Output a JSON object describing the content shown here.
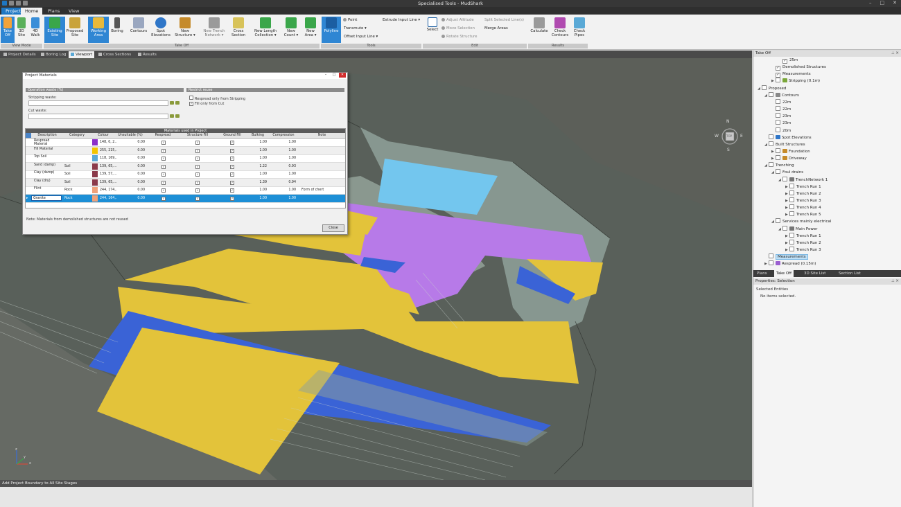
{
  "window": {
    "title": "Specialised Tools - MudShark",
    "min": "–",
    "max": "□",
    "close": "✕"
  },
  "ribbon_tabs": [
    "Project",
    "Home",
    "Plans",
    "View"
  ],
  "ribbon": {
    "take_off": "Take\nOff",
    "site_3d": "3D\nSite",
    "walk_4d": "4D\nWalk",
    "existing_site": "Existing\nSite",
    "proposed_site": "Proposed\nSite",
    "working_area": "Working\nArea",
    "boring": "Boring",
    "contours": "Contours",
    "spot_elevations": "Spot\nElevations",
    "new_structure": "New\nStructure ▾",
    "new_trench_network": "New Trench\nNetwork ▾",
    "cross_section": "Cross\nSection",
    "new_length_collection": "New Length\nCollection ▾",
    "new_count": "New\nCount ▾",
    "new_area": "New\nArea ▾",
    "polyline": "Polyline",
    "point": "Point",
    "transmute": "Transmute ▾",
    "offset_input_line": "Offset Input Line ▾",
    "extrude_input_line": "Extrude Input Line ▾",
    "select": "Select",
    "adjust_altitude": "Adjust Altitude",
    "move_selection": "Move Selection",
    "rotate_structure": "Rotate Structure",
    "split_selected_lines": "Split Selected Line(s)",
    "merge_areas": "Merge Areas",
    "calculate": "Calculate",
    "check_contours": "Check\nContours",
    "check_pipes": "Check\nPipes",
    "groups": {
      "view_mode": "View Mode",
      "take_off": "Take Off",
      "tools": "Tools",
      "edit": "Edit",
      "results": "Results"
    }
  },
  "doc_tabs": [
    "Project Details",
    "Boring Log",
    "Viewport",
    "Cross Sections",
    "Results"
  ],
  "status_bar": "Add Project Boundary to All Site Stages",
  "compass": {
    "n": "N",
    "s": "S",
    "e": "E",
    "w": "W",
    "top": "TOP"
  },
  "axes": {
    "x": "x",
    "y": "y",
    "z": "z"
  },
  "dialog": {
    "title": "Project Materials",
    "operation_waste": "Operation waste (%)",
    "stripping_waste": "Stripping waste:",
    "cut_waste": "Cut waste:",
    "restrict_reuse": "Restrict reuse",
    "respread_only": "Respread only from Stripping",
    "fill_only": "Fill only from Cut",
    "table_title": "Materials used in Project",
    "columns": {
      "description": "Description",
      "category": "Category",
      "colour": "Colour",
      "unsuitable": "Unsuitable (%)",
      "respread": "Respread",
      "structure_fill": "Structure Fill",
      "ground_fill": "Ground Fill",
      "bulking": "Bulking",
      "compression": "Compression",
      "note": "Note"
    },
    "rows": [
      {
        "description": "Respread Material",
        "category": "",
        "colour": "#8a2fc9",
        "colour_text": "148, 0, 2...",
        "unsuitable": "0.00",
        "bulking": "1.00",
        "compression": "1.00",
        "note": ""
      },
      {
        "description": "Fill Material",
        "category": "",
        "colour": "#f2c400",
        "colour_text": "255, 215,...",
        "unsuitable": "0.00",
        "bulking": "1.00",
        "compression": "1.00",
        "note": ""
      },
      {
        "description": "Top Soil",
        "category": "",
        "colour": "#5aa9d6",
        "colour_text": "118, 169,...",
        "unsuitable": "0.00",
        "bulking": "1.00",
        "compression": "1.00",
        "note": ""
      },
      {
        "description": "Sand (damp)",
        "category": "Soil",
        "colour": "#8b3a4a",
        "colour_text": "139, 65,...",
        "unsuitable": "0.00",
        "bulking": "1.22",
        "compression": "0.93",
        "note": ""
      },
      {
        "description": "Clay (damp)",
        "category": "Soil",
        "colour": "#8b3a4a",
        "colour_text": "139, 57,...",
        "unsuitable": "0.00",
        "bulking": "1.00",
        "compression": "1.00",
        "note": ""
      },
      {
        "description": "Clay (dry)",
        "category": "Soil",
        "colour": "#8b3a4a",
        "colour_text": "139, 65,...",
        "unsuitable": "0.00",
        "bulking": "1.39",
        "compression": "0.94",
        "note": ""
      },
      {
        "description": "Flint",
        "category": "Rock",
        "colour": "#f0a27a",
        "colour_text": "244, 174,...",
        "unsuitable": "0.00",
        "bulking": "1.00",
        "compression": "1.00",
        "note": "Form of chert"
      },
      {
        "description": "Granite",
        "category": "Rock",
        "colour": "#f0a27a",
        "colour_text": "244, 164,...",
        "unsuitable": "0.00",
        "bulking": "1.00",
        "compression": "1.00",
        "note": ""
      }
    ],
    "footnote": "Note: Materials from demolished structures are not reused",
    "close": "Close"
  },
  "take_off_panel": {
    "title": "Take Off",
    "nodes": [
      {
        "label": "25m",
        "indent": 3,
        "checked": true,
        "arrow": ""
      },
      {
        "label": "Demolished Structures",
        "indent": 2,
        "checked": true,
        "arrow": ""
      },
      {
        "label": "Measurements",
        "indent": 2,
        "checked": true,
        "arrow": ""
      },
      {
        "label": "Stripping (0.1m)",
        "indent": 2,
        "checked": false,
        "arrow": "▶",
        "icon": "#7aa63a"
      },
      {
        "label": "Proposed",
        "indent": 0,
        "checked": false,
        "arrow": "◢"
      },
      {
        "label": "Contours",
        "indent": 1,
        "checked": false,
        "arrow": "◢",
        "icon": "#888"
      },
      {
        "label": "22m",
        "indent": 2,
        "checked": false,
        "arrow": ""
      },
      {
        "label": "22m",
        "indent": 2,
        "checked": false,
        "arrow": ""
      },
      {
        "label": "23m",
        "indent": 2,
        "checked": false,
        "arrow": ""
      },
      {
        "label": "23m",
        "indent": 2,
        "checked": false,
        "arrow": ""
      },
      {
        "label": "20m",
        "indent": 2,
        "checked": false,
        "arrow": ""
      },
      {
        "label": "Spot Elevations",
        "indent": 1,
        "checked": false,
        "arrow": "",
        "icon": "#2f76c8"
      },
      {
        "label": "Built Structures",
        "indent": 1,
        "checked": false,
        "arrow": "◢"
      },
      {
        "label": "Foundation",
        "indent": 2,
        "checked": false,
        "arrow": "▶",
        "icon": "#c58a2a"
      },
      {
        "label": "Driveway",
        "indent": 2,
        "checked": false,
        "arrow": "▶",
        "icon": "#c58a2a"
      },
      {
        "label": "Trenching",
        "indent": 1,
        "checked": false,
        "arrow": "◢"
      },
      {
        "label": "Foul drains",
        "indent": 2,
        "checked": false,
        "arrow": "◢"
      },
      {
        "label": "TrenchNetwork 1",
        "indent": 3,
        "checked": false,
        "arrow": "◢",
        "icon": "#777"
      },
      {
        "label": "Trench Run 1",
        "indent": 4,
        "checked": false,
        "arrow": "▶"
      },
      {
        "label": "Trench Run 2",
        "indent": 4,
        "checked": false,
        "arrow": "▶"
      },
      {
        "label": "Trench Run 3",
        "indent": 4,
        "checked": false,
        "arrow": "▶"
      },
      {
        "label": "Trench Run 4",
        "indent": 4,
        "checked": false,
        "arrow": "▶"
      },
      {
        "label": "Trench Run 5",
        "indent": 4,
        "checked": false,
        "arrow": "▶"
      },
      {
        "label": "Services mainly electrical",
        "indent": 2,
        "checked": false,
        "arrow": "◢"
      },
      {
        "label": "Main Power",
        "indent": 3,
        "checked": false,
        "arrow": "◢",
        "icon": "#777"
      },
      {
        "label": "Trench Run 1",
        "indent": 4,
        "checked": false,
        "arrow": "▶"
      },
      {
        "label": "Trench Run 2",
        "indent": 4,
        "checked": false,
        "arrow": "▶"
      },
      {
        "label": "Trench Run 3",
        "indent": 4,
        "checked": false,
        "arrow": "▶"
      },
      {
        "label": "Measurements",
        "indent": 1,
        "checked": false,
        "arrow": "",
        "selected": true
      },
      {
        "label": "Respread (0.15m)",
        "indent": 1,
        "checked": false,
        "arrow": "▶",
        "icon": "#9b5fd0"
      }
    ]
  },
  "panel_tabs": [
    "Plans",
    "Take Off",
    "3D Site List",
    "Section List"
  ],
  "properties": {
    "title": "Properties: Selection",
    "selected_entities": "Selected Entities",
    "none": "No items selected."
  },
  "colors": {
    "yellow": "#e3c33a",
    "blue": "#3a63d6",
    "purple": "#b77ae8",
    "light_blue": "#73c6ee",
    "terrain": "#5c635a",
    "accent": "#1e77c3"
  }
}
